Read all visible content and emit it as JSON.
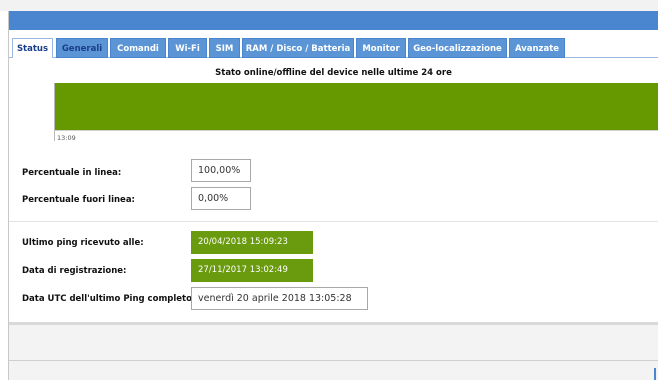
{
  "tabs": [
    {
      "label": "Status",
      "active": true
    },
    {
      "label": "Generali"
    },
    {
      "label": "Comandi"
    },
    {
      "label": "Wi-Fi"
    },
    {
      "label": "SIM"
    },
    {
      "label": "RAM / Disco / Batteria"
    },
    {
      "label": "Monitor"
    },
    {
      "label": "Geo-localizzazione"
    },
    {
      "label": "Avanzate"
    }
  ],
  "chart": {
    "title": "Stato online/offline del device nelle ultime 24 ore"
  },
  "chart_data": {
    "type": "area",
    "title": "Stato online/offline del device nelle ultime 24 ore",
    "x": [
      "13:09"
    ],
    "series": [
      {
        "values": [
          1
        ]
      }
    ],
    "xlabel": "",
    "ylabel": "",
    "grid": false,
    "color": "#669900"
  },
  "fields": {
    "online_pct": {
      "label": "Percentuale in linea:",
      "value": "100,00%"
    },
    "offline_pct": {
      "label": "Percentuale fuori linea:",
      "value": "0,00%"
    },
    "last_ping": {
      "label": "Ultimo ping ricevuto alle:",
      "value": "20/04/2018 15:09:23"
    },
    "registration": {
      "label": "Data di registrazione:",
      "value": "27/11/2017 13:02:49"
    },
    "utc_ping": {
      "label": "Data UTC dell'ultimo Ping completo:",
      "value": "venerdì 20 aprile 2018 13:05:28"
    }
  },
  "colors": {
    "accent": "#4a86cf",
    "online": "#669900"
  }
}
